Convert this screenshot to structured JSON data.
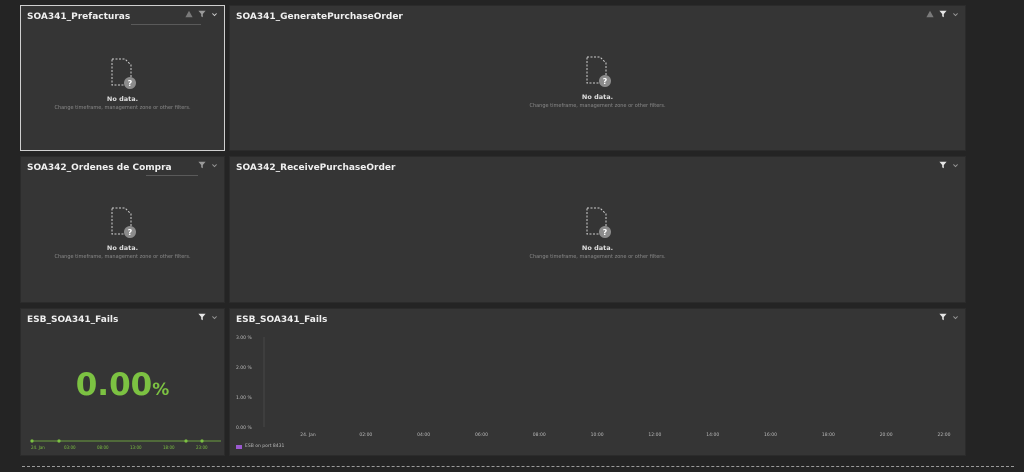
{
  "tiles": {
    "prefacturas": {
      "title": "SOA341_Prefacturas",
      "nodata_title": "No data.",
      "nodata_sub": "Change timeframe, management zone or other filters."
    },
    "generate_po": {
      "title": "SOA341_GeneratePurchaseOrder",
      "nodata_title": "No data.",
      "nodata_sub": "Change timeframe, management zone or other filters."
    },
    "ordenes": {
      "title": "SOA342_Ordenes de Compra",
      "nodata_title": "No data.",
      "nodata_sub": "Change timeframe, management zone or other filters."
    },
    "receive_po": {
      "title": "SOA342_ReceivePurchaseOrder",
      "nodata_title": "No data.",
      "nodata_sub": "Change timeframe, management zone or other filters."
    },
    "fails_single": {
      "title": "ESB_SOA341_Fails",
      "value": "0.00",
      "unit": "%",
      "spark_labels": [
        "24. Jan",
        "03:00",
        "08:00",
        "13:00",
        "18:00",
        "23:00"
      ]
    },
    "fails_chart": {
      "title": "ESB_SOA341_Fails",
      "legend": "ESB on port 8431"
    }
  },
  "chart_data": {
    "type": "line",
    "title": "ESB_SOA341_Fails",
    "y_ticks": [
      "3.00 %",
      "2.00 %",
      "1.00 %",
      "0.00 %"
    ],
    "ylim": [
      0,
      3
    ],
    "x_ticks": [
      "24. Jan",
      "02:00",
      "04:00",
      "06:00",
      "08:00",
      "10:00",
      "12:00",
      "14:00",
      "16:00",
      "18:00",
      "20:00",
      "22:00"
    ],
    "series": [
      {
        "name": "ESB on port 8431",
        "values": []
      }
    ],
    "grid": false,
    "legend_position": "bottom-left",
    "colors": {
      "series": "#9b59d0",
      "single_value": "#7cc242"
    }
  }
}
